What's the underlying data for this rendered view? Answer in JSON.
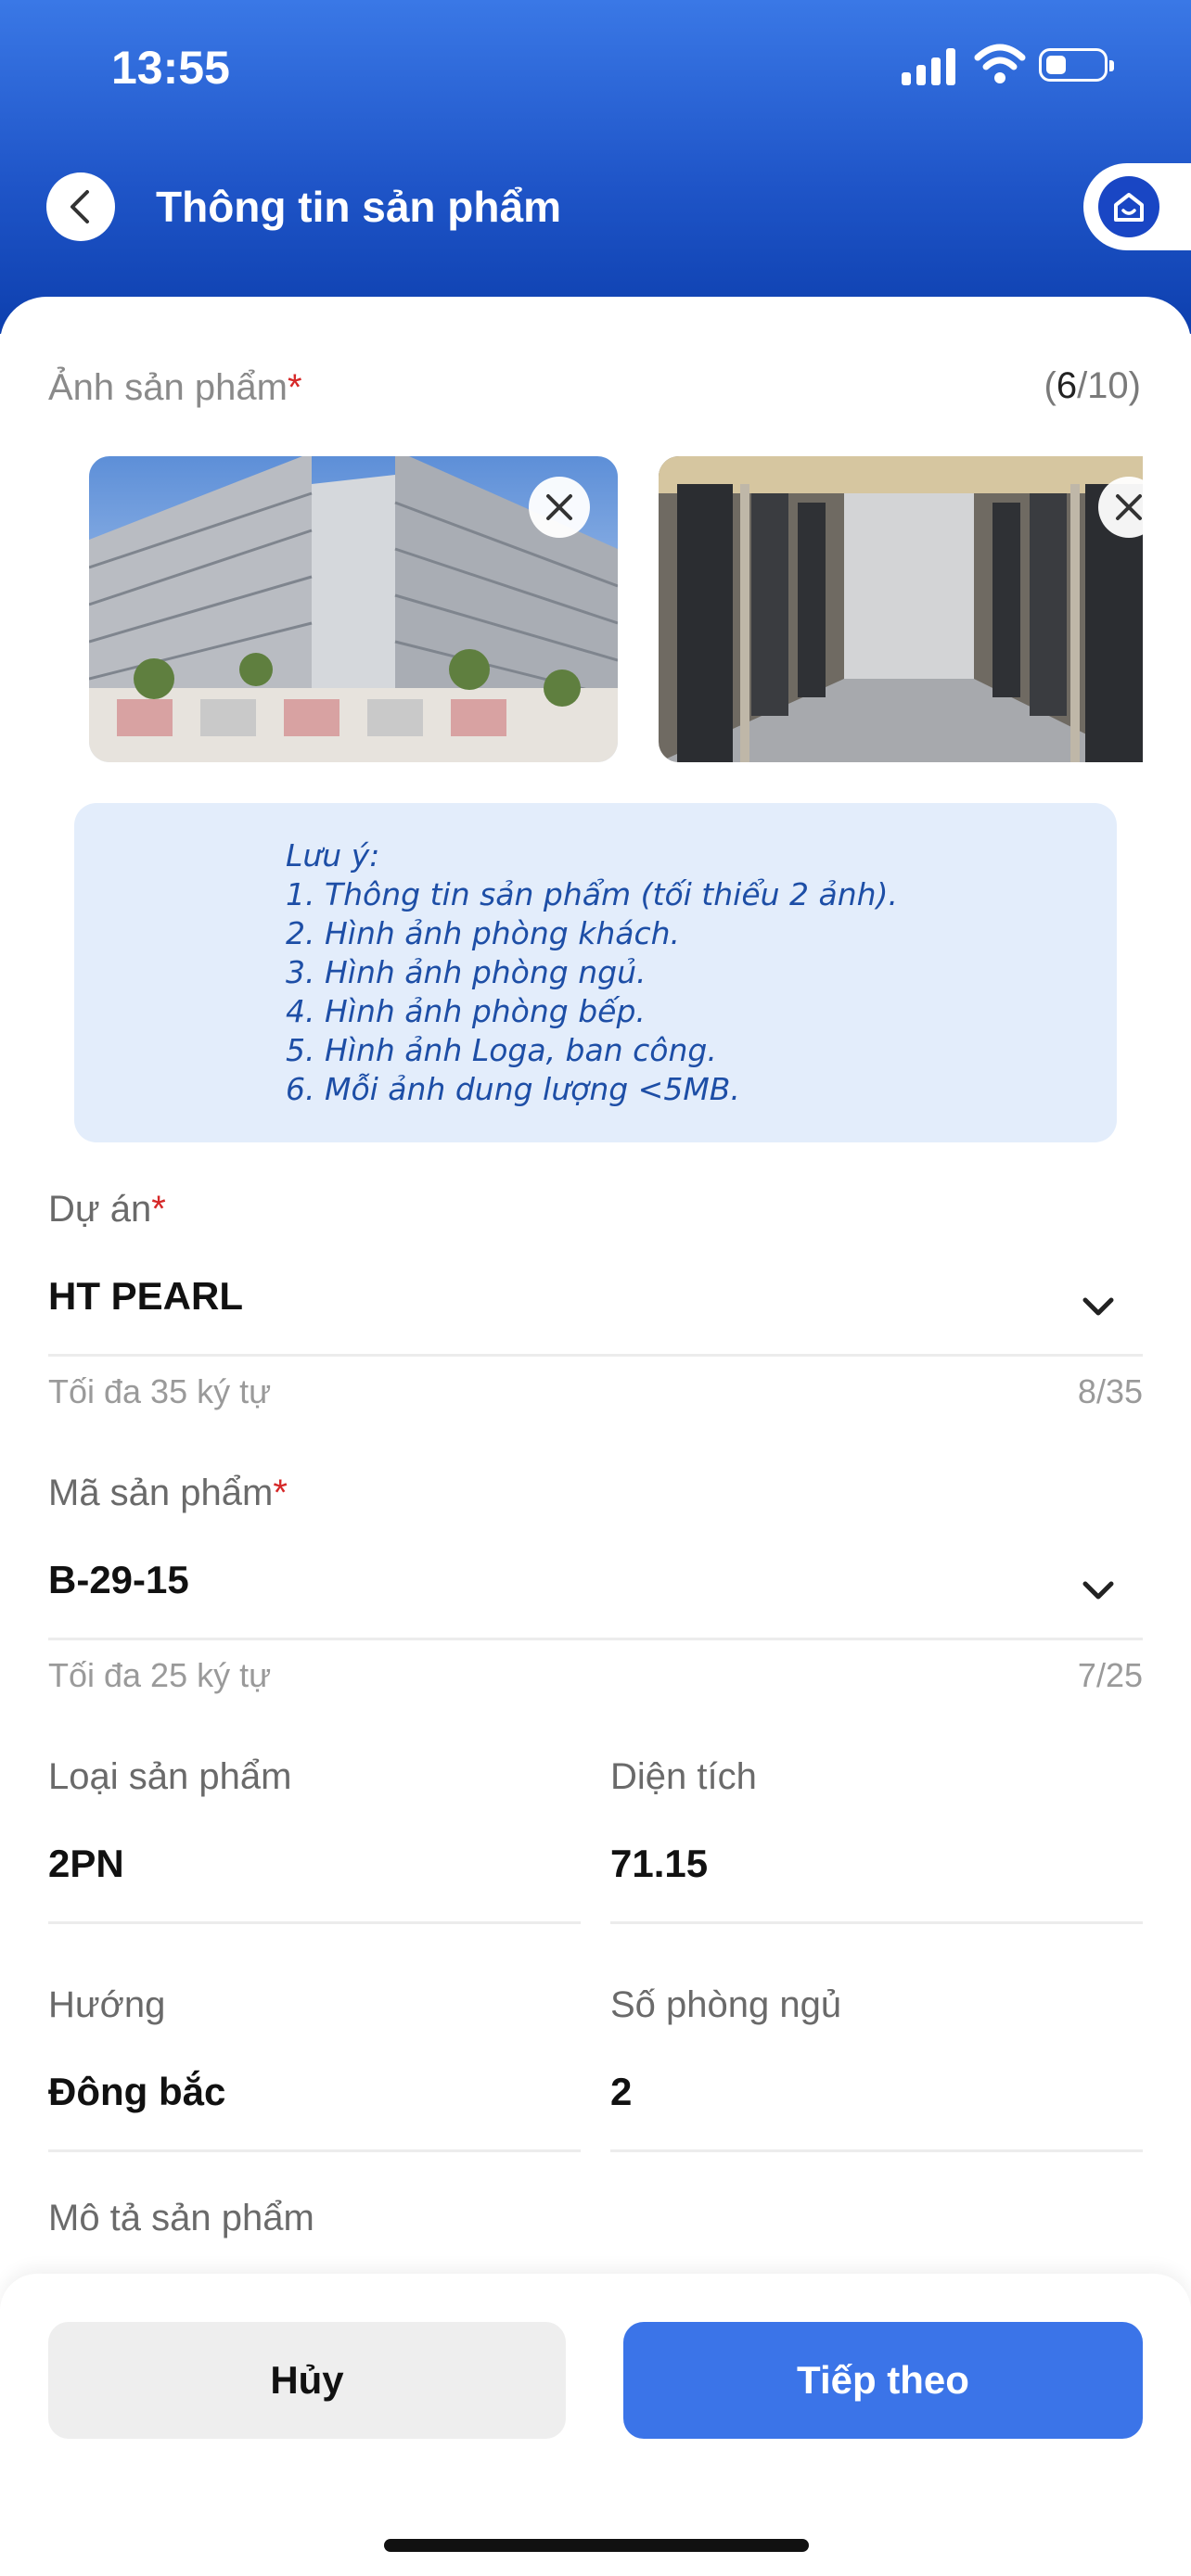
{
  "status_bar": {
    "time": "13:55",
    "battery_level": 0.35
  },
  "nav": {
    "title": "Thông tin sản phẩm",
    "back_icon": "chevron-left-icon",
    "home_icon": "home-icon"
  },
  "photos": {
    "label": "Ảnh sản phẩm",
    "required_mark": "*",
    "count_open": "(",
    "count_current": "6",
    "count_rest": "/10)",
    "items": [
      {
        "name": "building-facade-photo"
      },
      {
        "name": "elevator-lobby-photo"
      }
    ]
  },
  "note": {
    "lines": [
      "Lưu ý:",
      "1. Thông tin sản phẩm (tối thiểu 2 ảnh).",
      "2. Hình ảnh phòng khách.",
      "3. Hình ảnh phòng ngủ.",
      "4. Hình ảnh phòng bếp.",
      "5. Hình ảnh Loga, ban công.",
      "6. Mỗi ảnh dung lượng <5MB."
    ]
  },
  "project": {
    "label": "Dự án",
    "required_mark": "*",
    "value": "HT PEARL",
    "hint": "Tối đa 35 ký tự",
    "counter": "8/35"
  },
  "product_code": {
    "label": "Mã sản phẩm",
    "required_mark": "*",
    "value": "B-29-15",
    "hint": "Tối đa 25 ký tự",
    "counter": "7/25"
  },
  "product_type": {
    "label": "Loại sản phẩm",
    "value": "2PN"
  },
  "area": {
    "label": "Diện tích",
    "value": "71.15"
  },
  "direction": {
    "label": "Hướng",
    "value": "Đông bắc"
  },
  "bedrooms": {
    "label": "Số phòng ngủ",
    "value": "2"
  },
  "description": {
    "label": "Mô tả sản phẩm"
  },
  "footer": {
    "cancel_label": "Hủy",
    "next_label": "Tiếp theo"
  },
  "colors": {
    "primary": "#3b74e8",
    "header_dark": "#0d3fae",
    "note_bg": "#e3edfb",
    "note_text": "#1d4ea6",
    "required": "#d62828"
  }
}
